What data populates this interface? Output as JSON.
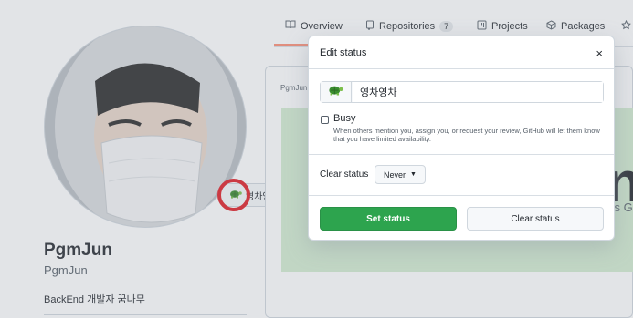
{
  "nav": {
    "tabs": [
      {
        "label": "Overview",
        "icon": "book-icon"
      },
      {
        "label": "Repositories",
        "icon": "repo-icon",
        "count": "7"
      },
      {
        "label": "Projects",
        "icon": "project-icon"
      },
      {
        "label": "Packages",
        "icon": "package-icon"
      },
      {
        "label": "",
        "icon": "star-icon"
      }
    ]
  },
  "profile": {
    "status_text": "영차영차",
    "name": "PgmJun",
    "login": "PgmJun",
    "bio": "BackEnd 개발자 꿈나무"
  },
  "readme": {
    "label": "PgmJun",
    "banner_big": "n",
    "banner_sub": "'s G"
  },
  "modal": {
    "title": "Edit status",
    "close_label": "×",
    "status_value": "영차영차",
    "busy_label": "Busy",
    "busy_desc": "When others mention you, assign you, or request your review, GitHub will let them know that you have limited availability.",
    "clear_status_label": "Clear status",
    "clear_status_value": "Never",
    "set_button": "Set status",
    "clear_button": "Clear status"
  },
  "colors": {
    "primary_button": "#2da44e",
    "highlight_ring": "#e11d24",
    "tab_underline": "#fd8c73",
    "banner": "#d3ecd0"
  }
}
